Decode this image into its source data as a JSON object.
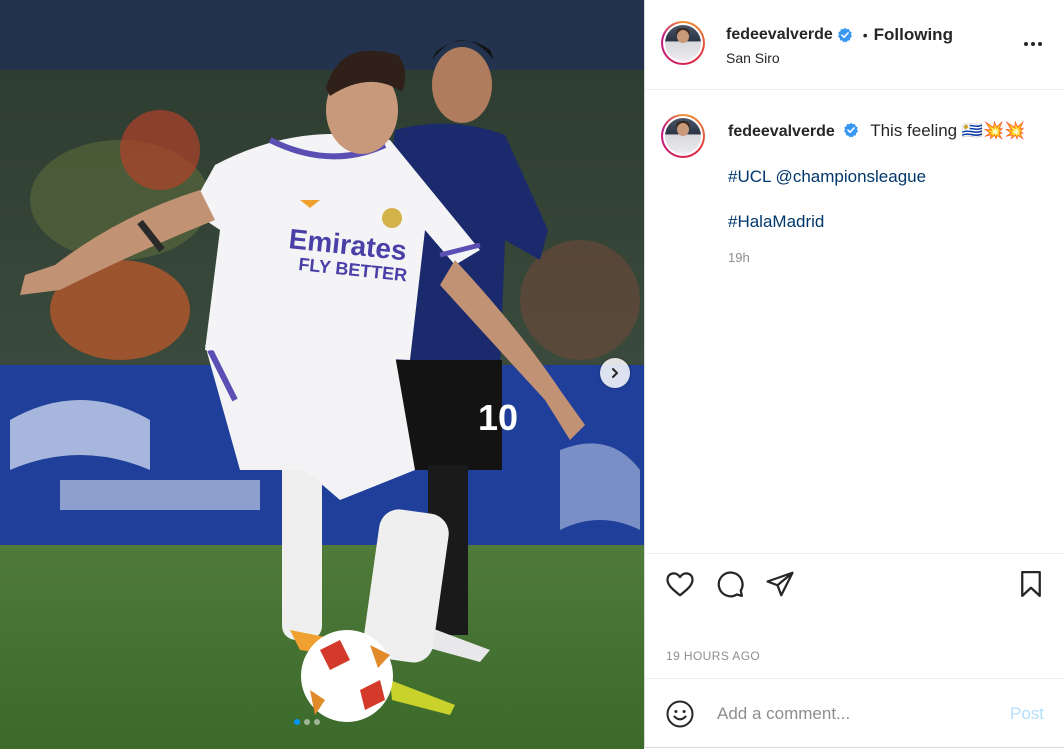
{
  "header": {
    "username": "fedeevalverde",
    "bullet": "•",
    "follow_status": "Following",
    "location": "San Siro"
  },
  "caption": {
    "username": "fedeevalverde",
    "text": "This feeling 🇺🇾💥💥",
    "hashtag_line": "#UCL @championsleague",
    "hashtag2": "#HalaMadrid",
    "age": "19h"
  },
  "timestamp": "19 HOURS AGO",
  "comment": {
    "placeholder": "Add a comment...",
    "post_label": "Post"
  },
  "photo": {
    "jersey_sponsor": "Emirates",
    "jersey_sponsor_sub": "FLY BETTER",
    "opponent_number": "10",
    "slide_count": 3,
    "current_slide": 1
  },
  "colors": {
    "verified": "#3897f0",
    "link": "#00376b",
    "post_disabled": "#b2dffc",
    "muted": "#8e8e8e",
    "carousel_active": "#0095f6"
  },
  "icons": [
    "verified-badge-icon",
    "more-options-icon",
    "heart-icon",
    "comment-icon",
    "share-icon",
    "bookmark-icon",
    "emoji-icon",
    "chevron-right-icon"
  ]
}
